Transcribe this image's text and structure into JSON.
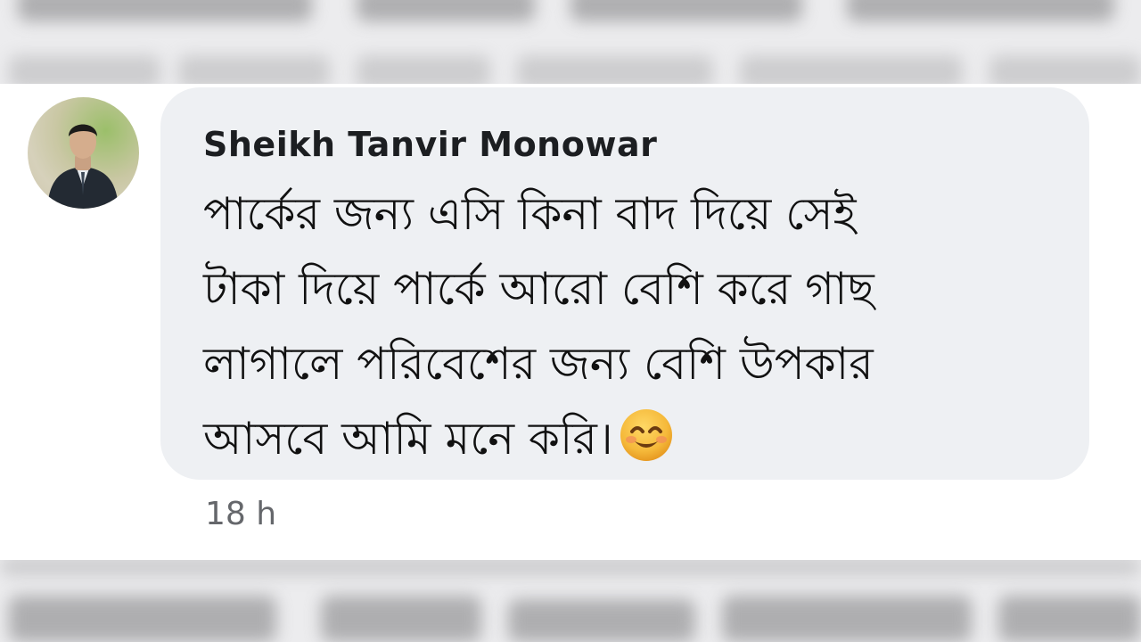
{
  "comment": {
    "author": "Sheikh Tanvir Monowar",
    "message_lines": [
      "পার্কের জন্য এসি কিনা বাদ দিয়ে সেই",
      "টাকা দিয়ে পার্কে আরো বেশি করে গাছ",
      "লাগালে পরিবেশের জন্য বেশি উপকার",
      "আসবে আমি মনে করি।"
    ],
    "emoji": "smiling-face-with-smiling-eyes",
    "timestamp": "18 h"
  },
  "colors": {
    "bubble": "#eef0f3",
    "author_text": "#1c1e21",
    "timestamp_text": "#65676b",
    "emoji_face": "#f5b93a"
  }
}
